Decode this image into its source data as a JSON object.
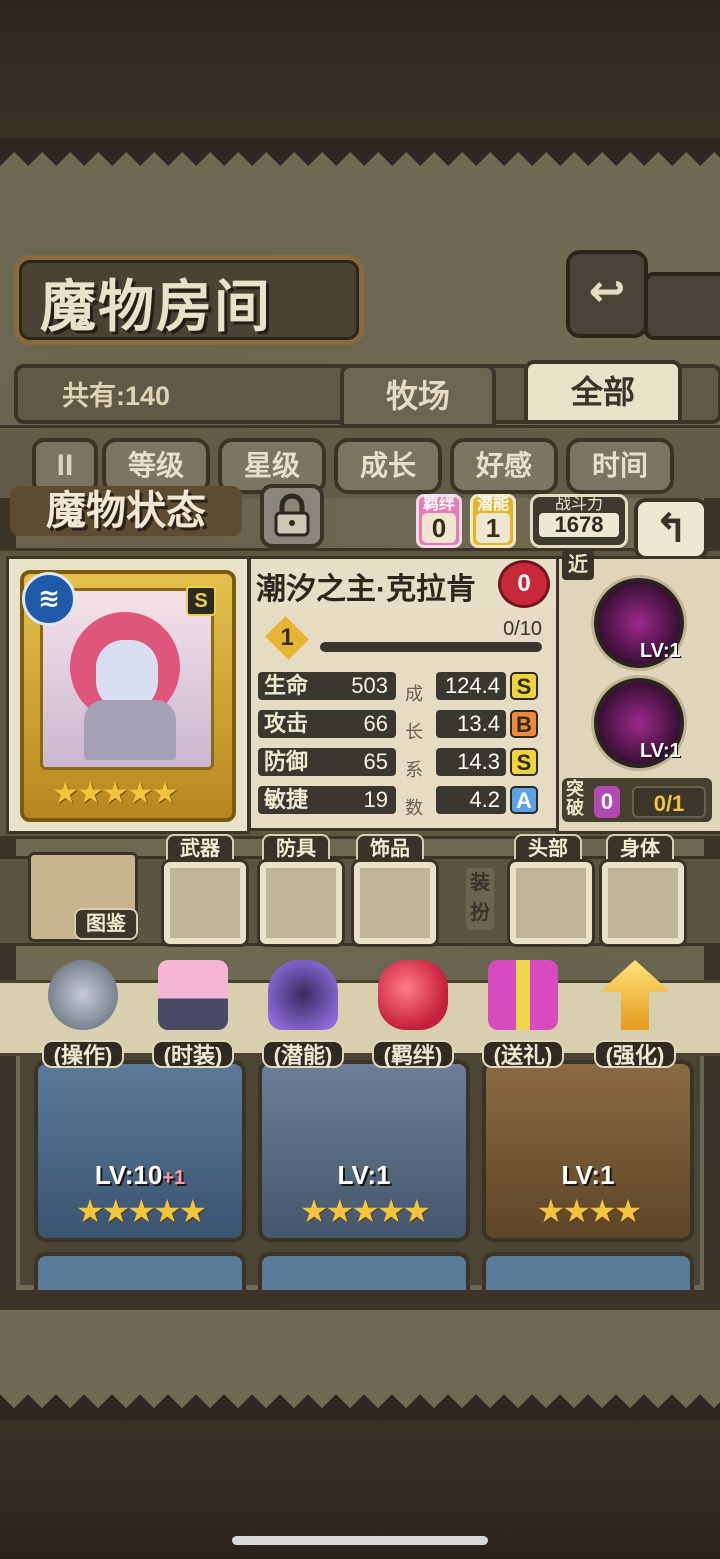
{
  "header": {
    "title": "魔物房间",
    "back_icon": "↩",
    "count_label": "共有:140"
  },
  "tabs": [
    {
      "label": "牧场",
      "active": false
    },
    {
      "label": "全部",
      "active": true
    }
  ],
  "sort_buttons": [
    "等级",
    "星级",
    "成长",
    "好感",
    "时间"
  ],
  "status": {
    "title": "魔物状态",
    "bond": {
      "label": "羁绊",
      "value": "0"
    },
    "potential": {
      "label": "潜能",
      "value": "1"
    },
    "power": {
      "label": "战斗力",
      "value": "1678"
    },
    "name": "潮汐之主·克拉肯",
    "heart_value": "0",
    "rank": "S",
    "level": "1",
    "exp": "0/10",
    "exp_progress": 0,
    "stars": "★★★★★",
    "stats": [
      {
        "key": "生命",
        "value": "503",
        "growth": "124.4",
        "grade": "S"
      },
      {
        "key": "攻击",
        "value": "66",
        "growth": "13.4",
        "grade": "B"
      },
      {
        "key": "防御",
        "value": "65",
        "growth": "14.3",
        "grade": "S"
      },
      {
        "key": "敏捷",
        "value": "19",
        "growth": "4.2",
        "grade": "A"
      }
    ],
    "growth_label": [
      "成",
      "长",
      "系",
      "数"
    ],
    "skills": {
      "type_label": "近",
      "items": [
        {
          "level": "LV:1"
        },
        {
          "level": "LV:1"
        }
      ]
    },
    "breakthrough": {
      "label": "突破",
      "value": "0",
      "progress": "0/1"
    }
  },
  "equipment": {
    "book_label": "图鉴",
    "slots": [
      "武器",
      "防具",
      "饰品",
      "头部",
      "身体"
    ],
    "dress_label": "装扮"
  },
  "actions": [
    "(操作)",
    "(时装)",
    "(潜能)",
    "(羁绊)",
    "(送礼)",
    "(强化)"
  ],
  "monster_cards": [
    {
      "level": "LV:10",
      "plus": "+1",
      "stars": "★★★★★"
    },
    {
      "level": "LV:1",
      "plus": "",
      "stars": "★★★★★"
    },
    {
      "level": "LV:1",
      "plus": "",
      "stars": "★★★★"
    }
  ],
  "colors": {
    "gold": "#f4c53c",
    "panel": "#e5dcc3",
    "dark": "#3a3428"
  }
}
